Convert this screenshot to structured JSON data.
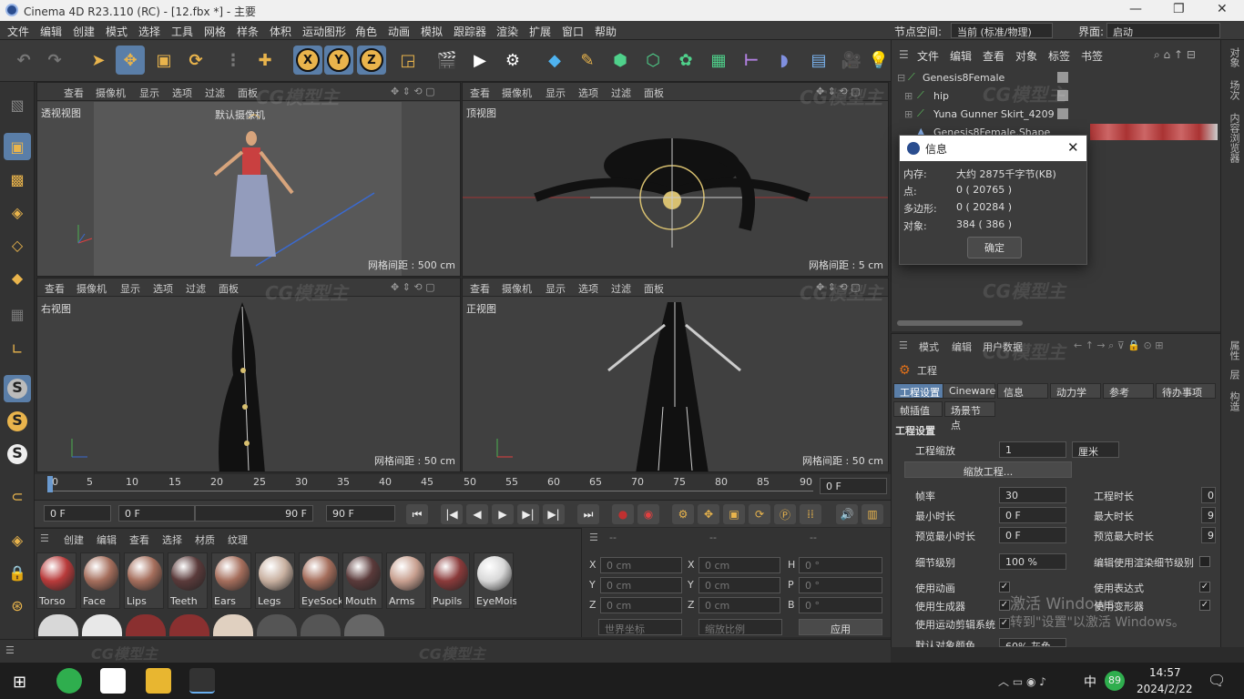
{
  "app": {
    "title": "Cinema 4D R23.110 (RC) - [12.fbx *] - 主要"
  },
  "menu": {
    "items": [
      "文件",
      "编辑",
      "创建",
      "模式",
      "选择",
      "工具",
      "网格",
      "样条",
      "体积",
      "运动图形",
      "角色",
      "动画",
      "模拟",
      "跟踪器",
      "渲染",
      "扩展",
      "窗口",
      "帮助"
    ],
    "node_space_label": "节点空间:",
    "node_space_value": "当前 (标准/物理)",
    "layout_label": "界面:",
    "layout_value": "启动"
  },
  "toolbar": {
    "axis_x": "X",
    "axis_y": "Y",
    "axis_z": "Z"
  },
  "viewports": {
    "header_items": [
      "查看",
      "摄像机",
      "显示",
      "选项",
      "过滤",
      "面板"
    ],
    "perspective": {
      "name": "透视视图",
      "camera": "默认摄像机",
      "grid": "网格间距 : 500 cm"
    },
    "top": {
      "name": "顶视图",
      "grid": "网格间距 : 5 cm"
    },
    "right": {
      "name": "右视图",
      "grid": "网格间距 : 50 cm"
    },
    "front": {
      "name": "正视图",
      "grid": "网格间距 : 50 cm"
    }
  },
  "timeline": {
    "ticks": [
      "0",
      "5",
      "10",
      "15",
      "20",
      "25",
      "30",
      "35",
      "40",
      "45",
      "50",
      "55",
      "60",
      "65",
      "70",
      "75",
      "80",
      "85",
      "90"
    ],
    "end_frame": "0 F",
    "current": "0 F",
    "range_start": "0 F",
    "range_end": "90 F",
    "range_end2": "90 F"
  },
  "materials": {
    "menu": [
      "创建",
      "编辑",
      "查看",
      "选择",
      "材质",
      "纹理"
    ],
    "items": [
      {
        "label": "Torso"
      },
      {
        "label": "Face"
      },
      {
        "label": "Lips"
      },
      {
        "label": "Teeth"
      },
      {
        "label": "Ears"
      },
      {
        "label": "Legs"
      },
      {
        "label": "EyeSock"
      },
      {
        "label": "Mouth"
      },
      {
        "label": "Arms"
      },
      {
        "label": "Pupils"
      },
      {
        "label": "EyeMois"
      }
    ],
    "colors": [
      "#b83a3a",
      "#a56e5c",
      "#a56e5c",
      "#5a3a3a",
      "#a56e5c",
      "#c8b0a0",
      "#a56e5c",
      "#5a3a3a",
      "#c8a090",
      "#8a3a3a",
      "#d8d8d8"
    ]
  },
  "coords": {
    "header": [
      "--",
      "--",
      "--"
    ],
    "rows": [
      {
        "a": "X",
        "av": "0 cm",
        "b": "X",
        "bv": "0 cm",
        "c": "H",
        "cv": "0 °"
      },
      {
        "a": "Y",
        "av": "0 cm",
        "b": "Y",
        "bv": "0 cm",
        "c": "P",
        "cv": "0 °"
      },
      {
        "a": "Z",
        "av": "0 cm",
        "b": "Z",
        "bv": "0 cm",
        "c": "B",
        "cv": "0 °"
      }
    ],
    "world": "世界坐标",
    "scale": "缩放比例",
    "apply": "应用"
  },
  "object_manager": {
    "menu": [
      "文件",
      "编辑",
      "查看",
      "对象",
      "标签",
      "书签"
    ],
    "objects": [
      {
        "name": "Genesis8Female"
      },
      {
        "name": "hip"
      },
      {
        "name": "Yuna Gunner Skirt_4209"
      },
      {
        "name": "Genesis8Female.Shape"
      }
    ]
  },
  "info_dialog": {
    "title": "信息",
    "rows": [
      {
        "k": "内存:",
        "v": "大约 2875千字节(KB)"
      },
      {
        "k": "点:",
        "v": "0 ( 20765 )"
      },
      {
        "k": "多边形:",
        "v": "0 ( 20284 )"
      },
      {
        "k": "对象:",
        "v": "384 ( 386 )"
      }
    ],
    "ok": "确定"
  },
  "attributes": {
    "menu": [
      "模式",
      "编辑",
      "用户数据"
    ],
    "object": "工程",
    "tabs": [
      "工程设置",
      "Cineware",
      "信息",
      "动力学",
      "参考",
      "待办事项"
    ],
    "tabs2": [
      "帧插值",
      "场景节点"
    ],
    "section": "工程设置",
    "scale_label": "工程缩放",
    "scale_value": "1",
    "scale_unit": "厘米",
    "scale_button": "缩放工程...",
    "left": [
      {
        "k": "帧率",
        "v": "30"
      },
      {
        "k": "最小时长",
        "v": "0 F"
      },
      {
        "k": "预览最小时长",
        "v": "0 F"
      },
      {
        "k": "细节级别",
        "v": "100 %"
      }
    ],
    "right": [
      {
        "k": "工程时长",
        "v": "0"
      },
      {
        "k": "最大时长",
        "v": "9"
      },
      {
        "k": "预览最大时长",
        "v": "9"
      },
      {
        "k": "编辑使用渲染细节级别",
        "v": ""
      }
    ],
    "checks_left": [
      "使用动画",
      "使用生成器",
      "使用运动剪辑系统"
    ],
    "checks_right": [
      "使用表达式",
      "使用变形器"
    ],
    "default_color_label": "默认对象颜色",
    "default_color_value": "60% 灰色"
  },
  "right_strip": [
    "对象",
    "场次",
    "内容浏览器",
    "属性",
    "层",
    "构造"
  ],
  "watermark": "CG模型主",
  "watermark_url": "WWW.CGMXW.COM",
  "activation": {
    "line1": "激活 Windows",
    "line2": "转到\"设置\"以激活 Windows。"
  },
  "taskbar": {
    "time": "14:57",
    "date": "2024/2/22",
    "ime": "中",
    "badge": "89"
  }
}
